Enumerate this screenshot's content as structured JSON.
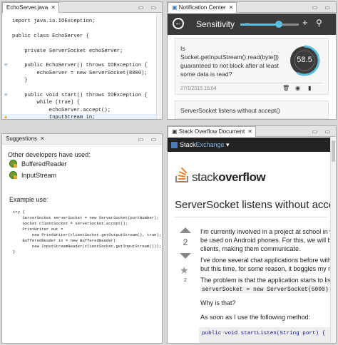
{
  "editor": {
    "tab_label": "EchoServer.java",
    "lines": [
      "import java.io.IOException;",
      "",
      "public class EchoServer {",
      "",
      "    private ServerSocket echoServer;",
      "",
      "    public EchoServer() throws IOException {",
      "        echoServer = new ServerSocket(8000);",
      "    }",
      "",
      "    public void start() throws IOException {",
      "        while (true) {",
      "            echoServer.accept();",
      "            InputStream in;",
      "        }",
      "    }",
      "}"
    ]
  },
  "notification": {
    "tab_label": "Notification Center",
    "sensitivity_label": "Sensitivity",
    "sensitivity_level": 0.66,
    "cards": [
      {
        "text": "Is Socket.getInputStream().read(byte[]) guaranteed to not block after at least some data is read?",
        "score": "58.5",
        "score_fraction": 0.585,
        "date": "27/1/2015 16:04"
      },
      {
        "text": "ServerSocket listens without accept()"
      }
    ]
  },
  "suggestions": {
    "tab_label": "Suggestions",
    "heading": "Other developers have used:",
    "items": [
      "BufferedReader",
      "InputStream"
    ],
    "example_label": "Example use:",
    "example_code": [
      "try {",
      "    ServerSocket serverSocket = new ServerSocket(portNumber);",
      "    Socket clientSocket = serverSocket.accept();",
      "    PrintWriter out =",
      "        new PrintWriter(clientSocket.getOutputStream(), true);",
      "    BufferedReader in = new BufferedReader(",
      "        new InputStreamReader(clientSocket.getInputStream()));",
      "}"
    ]
  },
  "stackoverflow": {
    "tab_label": "Stack Overflow Document",
    "network_prefix": "Stack",
    "network_suffix": "Exchange",
    "logo_text_1": "stack",
    "logo_text_2": "overflow",
    "question_title": "ServerSocket listens without accep",
    "vote_count": "2",
    "fav_count": "2",
    "paragraphs": [
      "I'm currently involved in a project at school in w",
      "be used on Android phones. For this, we will be",
      "clients, making them communicate.",
      "I've done several chat applications before withou",
      "but this time, for some reason, it boggles my m",
      "The problem is that the application starts to liste"
    ],
    "code_inline": "serverSocket = new ServerSocket(5000)",
    "code_inline_suffix": ", and r",
    "why": "Why is that?",
    "as_soon": "As soon as I use the following method:",
    "code_block": "public void startListen(String port) {"
  }
}
